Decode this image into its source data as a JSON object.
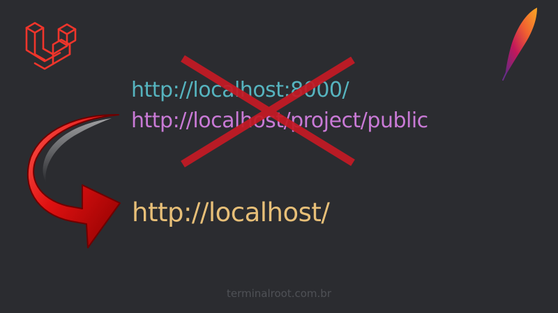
{
  "logos": {
    "laravel": "laravel-logo",
    "apache": "apache-feather-logo"
  },
  "urls": {
    "port_url": "http://localhost:8000/",
    "public_url": "http://localhost/project/public",
    "target_url": "http://localhost/"
  },
  "footer": {
    "credit": "terminalroot.com.br"
  },
  "colors": {
    "background": "#2b2c30",
    "port_url": "#56b4bf",
    "public_url": "#c97ad6",
    "target_url": "#e7bf78",
    "cross": "#c41a25",
    "arrow": "#d90f0f",
    "laravel": "#f0352b"
  },
  "icons": {
    "cross": "cross-out-icon",
    "arrow": "curved-arrow-icon"
  }
}
